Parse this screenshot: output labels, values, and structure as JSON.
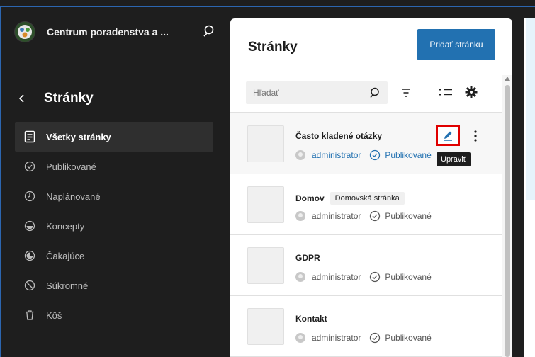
{
  "sidebar": {
    "site_name": "Centrum poradenstva a ...",
    "section_title": "Stránky",
    "items": [
      {
        "label": "Všetky stránky",
        "icon": "pages-icon",
        "active": true
      },
      {
        "label": "Publikované",
        "icon": "published-icon"
      },
      {
        "label": "Naplánované",
        "icon": "scheduled-icon"
      },
      {
        "label": "Koncepty",
        "icon": "draft-icon"
      },
      {
        "label": "Čakajúce",
        "icon": "pending-icon"
      },
      {
        "label": "Súkromné",
        "icon": "private-icon"
      },
      {
        "label": "Kôš",
        "icon": "trash-icon"
      }
    ]
  },
  "main": {
    "title": "Stránky",
    "add_button": "Pridať stránku",
    "search_placeholder": "Hľadať",
    "rows": [
      {
        "title": "Často kladené otázky",
        "author": "administrator",
        "status": "Publikované"
      },
      {
        "title": "Domov",
        "badge": "Domovská stránka",
        "author": "administrator",
        "status": "Publikované"
      },
      {
        "title": "GDPR",
        "author": "administrator",
        "status": "Publikované"
      },
      {
        "title": "Kontakt",
        "author": "administrator",
        "status": "Publikované"
      }
    ],
    "tooltip": "Upraviť"
  },
  "colors": {
    "accent": "#2271b1",
    "sidebar_bg": "#1e1e1e",
    "highlight_border": "#e00000"
  }
}
